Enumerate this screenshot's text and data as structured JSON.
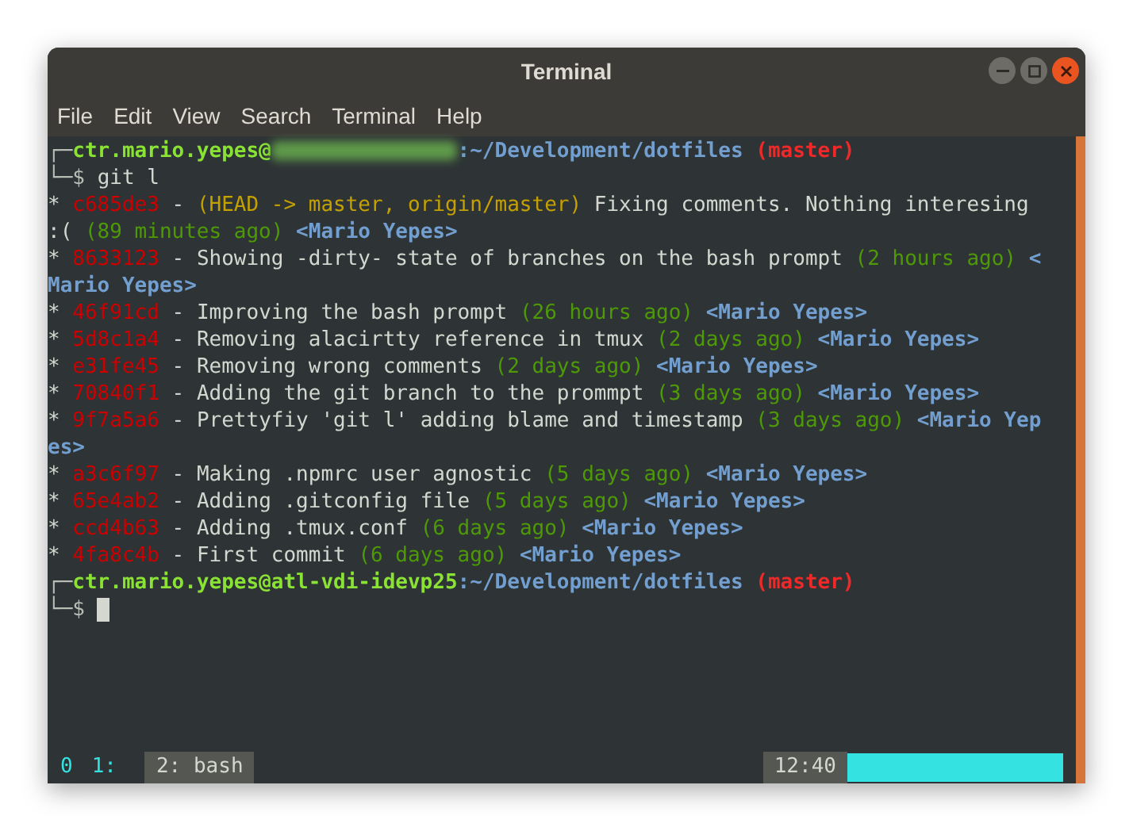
{
  "window": {
    "title": "Terminal"
  },
  "menu": [
    "File",
    "Edit",
    "View",
    "Search",
    "Terminal",
    "Help"
  ],
  "terminal": {
    "lines": [
      {
        "kind": "prompt",
        "corner": "┌─",
        "user": "ctr.mario.yepes@",
        "host_hidden": true,
        "separator": ":",
        "path": "~/Development/dotfiles",
        "branch": "(master)"
      },
      {
        "kind": "command",
        "corner": "└─",
        "symbol": "$",
        "text": "git l"
      },
      {
        "kind": "commit",
        "bullet": "*",
        "hash": "c685de3",
        "dash": "-",
        "refs": "(HEAD -> master, origin/master)",
        "message": "Fixing comments. Nothing interesing :(",
        "time": "(89 minutes ago)",
        "author": "<Mario Yepes>"
      },
      {
        "kind": "commit",
        "bullet": "*",
        "hash": "8633123",
        "dash": "-",
        "message": "Showing -dirty- state of branches on the bash prompt",
        "time": "(2 hours ago)",
        "author": "<Mario Yepes>"
      },
      {
        "kind": "commit",
        "bullet": "*",
        "hash": "46f91cd",
        "dash": "-",
        "message": "Improving the bash prompt",
        "time": "(26 hours ago)",
        "author": "<Mario Yepes>"
      },
      {
        "kind": "commit",
        "bullet": "*",
        "hash": "5d8c1a4",
        "dash": "-",
        "message": "Removing alacirtty reference in tmux",
        "time": "(2 days ago)",
        "author": "<Mario Yepes>"
      },
      {
        "kind": "commit",
        "bullet": "*",
        "hash": "e31fe45",
        "dash": "-",
        "message": "Removing wrong comments",
        "time": "(2 days ago)",
        "author": "<Mario Yepes>"
      },
      {
        "kind": "commit",
        "bullet": "*",
        "hash": "70840f1",
        "dash": "-",
        "message": "Adding the git branch to the prommpt",
        "time": "(3 days ago)",
        "author": "<Mario Yepes>"
      },
      {
        "kind": "commit",
        "bullet": "*",
        "hash": "9f7a5a6",
        "dash": "-",
        "message": "Prettyfiy 'git l' adding blame and timestamp",
        "time": "(3 days ago)",
        "author": "<Mario Yepes>"
      },
      {
        "kind": "commit",
        "bullet": "*",
        "hash": "a3c6f97",
        "dash": "-",
        "message": "Making .npmrc user agnostic",
        "time": "(5 days ago)",
        "author": "<Mario Yepes>"
      },
      {
        "kind": "commit",
        "bullet": "*",
        "hash": "65e4ab2",
        "dash": "-",
        "message": "Adding .gitconfig file",
        "time": "(5 days ago)",
        "author": "<Mario Yepes>"
      },
      {
        "kind": "commit",
        "bullet": "*",
        "hash": "ccd4b63",
        "dash": "-",
        "message": "Adding .tmux.conf",
        "time": "(6 days ago)",
        "author": "<Mario Yepes>"
      },
      {
        "kind": "commit",
        "bullet": "*",
        "hash": "4fa8c4b",
        "dash": "-",
        "message": "First commit",
        "time": "(6 days ago)",
        "author": "<Mario Yepes>"
      },
      {
        "kind": "prompt",
        "corner": "┌─",
        "user": "ctr.mario.yepes@",
        "host_hidden": false,
        "host": "atl-vdi-idevp25",
        "separator": ":",
        "path": "~/Development/dotfiles",
        "branch": "(master)"
      },
      {
        "kind": "input",
        "corner": "└─",
        "symbol": "$"
      }
    ]
  },
  "status_bar": {
    "session": "0",
    "windows": [
      {
        "label": "1:",
        "selected": false
      },
      {
        "label": "2: bash",
        "selected": true
      }
    ],
    "clock": "12:40"
  }
}
